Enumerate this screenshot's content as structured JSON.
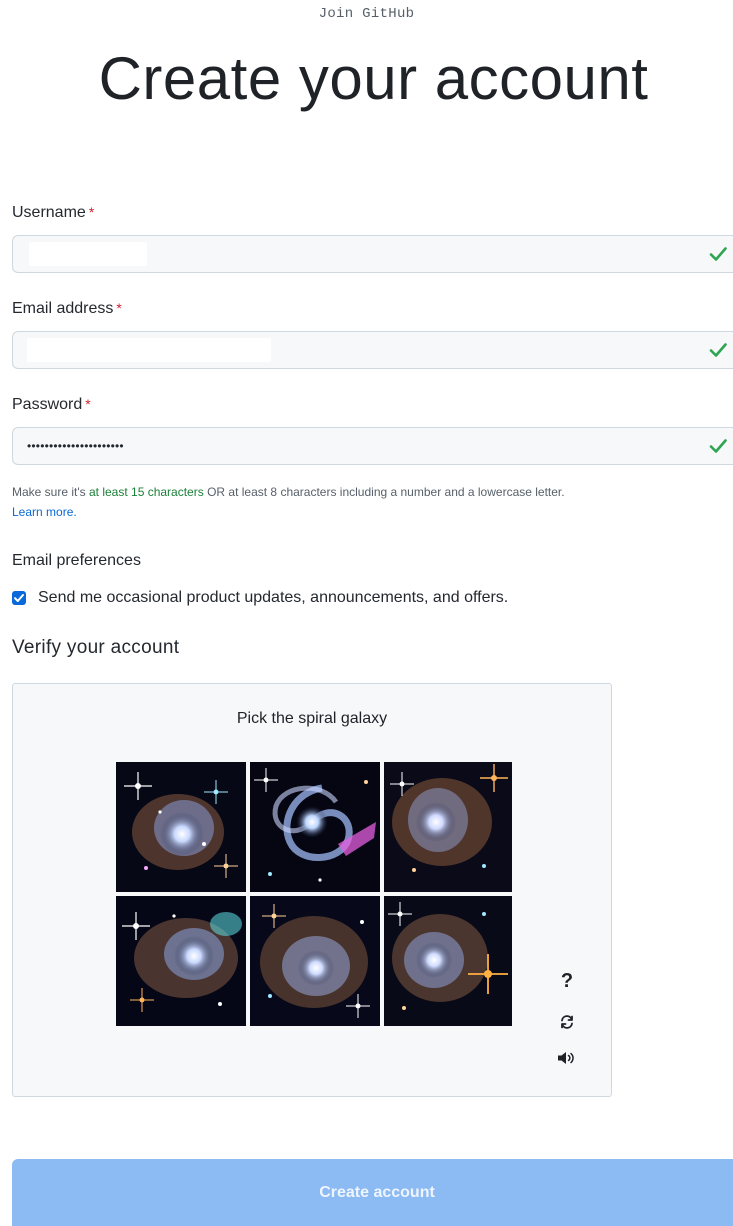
{
  "header": {
    "overline": "Join GitHub",
    "title": "Create your account"
  },
  "form": {
    "required_marker": "*",
    "username": {
      "label": "Username",
      "value": ""
    },
    "email": {
      "label": "Email address",
      "value": ""
    },
    "password": {
      "label": "Password",
      "value": "••••••••••••••••••••••"
    },
    "password_hint": {
      "prefix": "Make sure it's",
      "highlight": "at least 15 characters",
      "suffix": "OR at least 8 characters including a number and a lowercase letter.",
      "link": "Learn more."
    },
    "valid_icon": "check-icon",
    "valid_color": "#2da44e"
  },
  "email_preferences": {
    "title": "Email preferences",
    "checkbox_label": "Send me occasional product updates, announcements, and offers.",
    "checked": true
  },
  "verify": {
    "title": "Verify your account",
    "prompt": "Pick the spiral galaxy",
    "tiles": [
      {
        "kind": "nebula"
      },
      {
        "kind": "spiral galaxy"
      },
      {
        "kind": "nebula"
      },
      {
        "kind": "nebula"
      },
      {
        "kind": "nebula"
      },
      {
        "kind": "nebula"
      }
    ],
    "tools": {
      "help": "?",
      "refresh_icon": "refresh-icon",
      "audio_icon": "audio-icon"
    }
  },
  "submit": {
    "label": "Create account",
    "color": "#8cbaf2"
  }
}
